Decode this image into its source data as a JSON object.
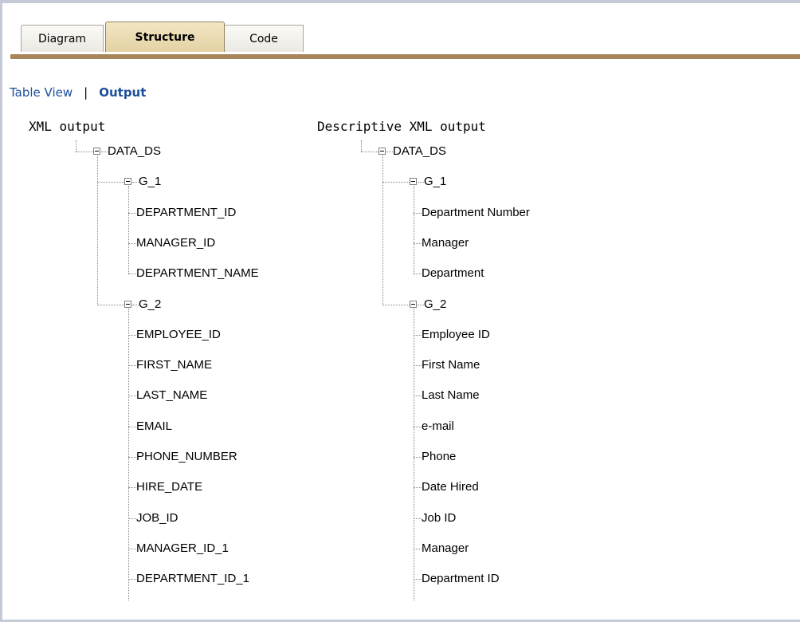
{
  "tabs": [
    {
      "label": "Diagram"
    },
    {
      "label": "Structure"
    },
    {
      "label": "Code"
    }
  ],
  "subnav": {
    "table_view": "Table View",
    "separator": "|",
    "output": "Output"
  },
  "xml_output": {
    "heading": "XML output",
    "root": "DATA_DS",
    "g1": {
      "label": "G_1",
      "fields": [
        "DEPARTMENT_ID",
        "MANAGER_ID",
        "DEPARTMENT_NAME"
      ]
    },
    "g2": {
      "label": "G_2",
      "fields": [
        "EMPLOYEE_ID",
        "FIRST_NAME",
        "LAST_NAME",
        "EMAIL",
        "PHONE_NUMBER",
        "HIRE_DATE",
        "JOB_ID",
        "MANAGER_ID_1",
        "DEPARTMENT_ID_1"
      ]
    }
  },
  "descriptive_output": {
    "heading": "Descriptive XML output",
    "root": "DATA_DS",
    "g1": {
      "label": "G_1",
      "fields": [
        "Department Number",
        "Manager",
        "Department"
      ]
    },
    "g2": {
      "label": "G_2",
      "fields": [
        "Employee ID",
        "First Name",
        "Last Name",
        "e-mail",
        "Phone",
        "Date Hired",
        "Job ID",
        "Manager",
        "Department ID"
      ]
    }
  },
  "colors": {
    "link": "#1c4f9c",
    "active_tab": "#e3d2a4",
    "tab_line": "#a8865c",
    "frame_border": "#c5cad9"
  }
}
